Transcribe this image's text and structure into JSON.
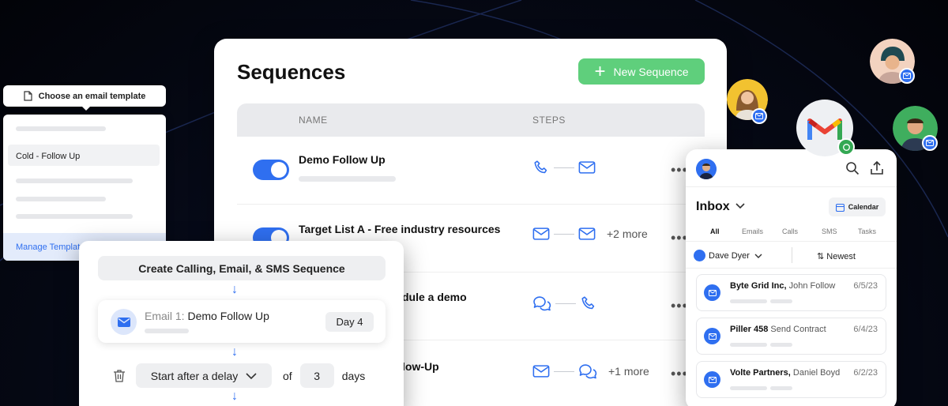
{
  "sequences": {
    "title": "Sequences",
    "new_button": "New Sequence",
    "columns": {
      "name": "NAME",
      "steps": "STEPS"
    },
    "rows": [
      {
        "name": "Demo Follow Up",
        "steps": [
          "phone-icon",
          "mail-icon"
        ],
        "more": ""
      },
      {
        "name": "Target List A - Free industry resources",
        "steps": [
          "mail-icon",
          "mail-icon"
        ],
        "more": "+2 more"
      },
      {
        "name": "dule a demo",
        "steps": [
          "chat-icon",
          "phone-icon"
        ],
        "more": ""
      },
      {
        "name": "low-Up",
        "steps": [
          "mail-icon",
          "chat-icon"
        ],
        "more": "+1 more"
      }
    ]
  },
  "template_picker": {
    "title": "Choose an email template",
    "selected_item": "Cold - Follow Up",
    "manage": "Manage Templat"
  },
  "create_sequence": {
    "title": "Create Calling, Email, & SMS Sequence",
    "step_prefix": "Email 1:",
    "step_name": "Demo Follow Up",
    "day": "Day 4",
    "delay_select": "Start after a delay",
    "of": "of",
    "delay_value": "3",
    "days": "days"
  },
  "inbox": {
    "title": "Inbox",
    "calendar": "Calendar",
    "tabs": [
      "All",
      "Emails",
      "Calls",
      "SMS",
      "Tasks"
    ],
    "user_filter": "Dave Dyer",
    "sort": "Newest",
    "messages": [
      {
        "company": "Byte Grid Inc,",
        "contact": "John Follow",
        "date": "6/5/23"
      },
      {
        "company": "Piller 458",
        "contact": "Send Contract",
        "date": "6/4/23"
      },
      {
        "company": "Volte Partners,",
        "contact": "Daniel Boyd",
        "date": "6/2/23"
      }
    ]
  },
  "colors": {
    "accent": "#2f6ff0",
    "green": "#5fcf7c",
    "background": "#05070f"
  }
}
